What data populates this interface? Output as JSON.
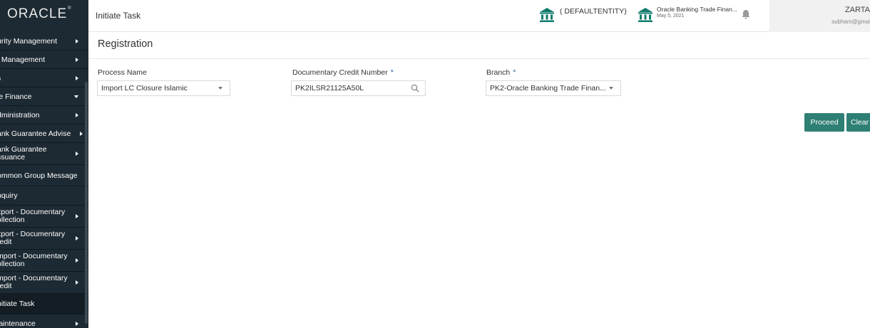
{
  "sidebar": {
    "logo": "ORACLE",
    "items": [
      {
        "label": "urity Management",
        "arrow": "right"
      },
      {
        "label": ": Management",
        "arrow": "right"
      },
      {
        "label": "s",
        "arrow": "right"
      },
      {
        "label": "le Finance",
        "arrow": "down"
      },
      {
        "label": "dministration",
        "arrow": "right"
      },
      {
        "label": "ank Guarantee Advise",
        "arrow": "right"
      },
      {
        "label": "ank Guarantee\nssuance",
        "arrow": "right"
      },
      {
        "label": "ommon Group Message",
        "arrow": ""
      },
      {
        "label": "nquiry",
        "arrow": ""
      },
      {
        "label": "xport - Documentary\nollection",
        "arrow": "right"
      },
      {
        "label": "xport - Documentary\nredit",
        "arrow": "right"
      },
      {
        "label": "mport - Documentary\nollection",
        "arrow": "right"
      },
      {
        "label": "mport - Documentary\nredit",
        "arrow": "right"
      },
      {
        "label": "nitiate Task",
        "arrow": ""
      },
      {
        "label": "laintenance",
        "arrow": "right"
      }
    ]
  },
  "header": {
    "title": "Initiate Task",
    "entity": "( DEFAULTENTITY)",
    "branch_name": "Oracle Banking Trade Finan...",
    "branch_date": "May 5, 2021",
    "user_name": "ZARTA",
    "user_email": "subham@gmai"
  },
  "main": {
    "section_title": "Registration",
    "fields": {
      "process_name": {
        "label": "Process Name",
        "value": "Import LC Closure Islamic"
      },
      "dc_number": {
        "label": "Documentary Credit Number",
        "value": "PK2ILSR21125A50L"
      },
      "branch": {
        "label": "Branch",
        "value": "PK2-Oracle Banking Trade Finan..."
      }
    },
    "required_mark": "*",
    "buttons": {
      "proceed": "Proceed",
      "clear": "Clear"
    }
  },
  "colors": {
    "sidebar_bg": "#1d2a33",
    "accent": "#2e7f74",
    "bank_icon": "#0f7b6b"
  }
}
